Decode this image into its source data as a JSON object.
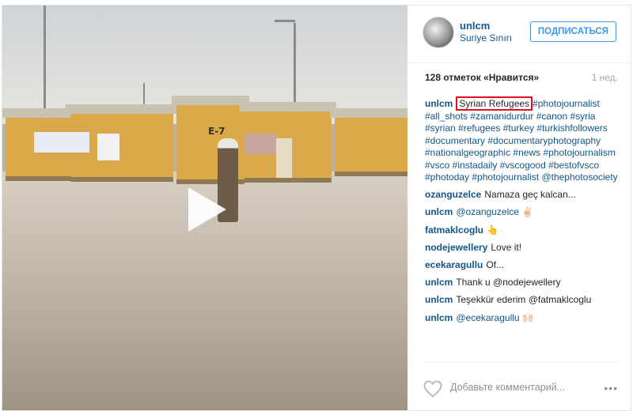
{
  "post": {
    "user": "unlcm",
    "location": "Suriye Sınırı",
    "follow_label": "ПОДПИСАТЬСЯ",
    "likes": "128 отметок «Нравится»",
    "time": "1 нед.",
    "video_sign": "E-7",
    "caption": {
      "author": "unlcm",
      "highlighted_text": "Syrian Refugees",
      "hashtags_line": "#photojournalist #all_shots #zamanidurdur #canon #syria #syrian #refugees #turkey #turkishfollowers #documentary #documentaryphotography #nationalgeographic #news #photojournalism #vsco #instadaily #vscogood #bestofvsco #photoday #photojournalist @thephotosociety"
    },
    "comments": [
      {
        "author": "ozanguzelce",
        "text": "Namaza geç kalcan..."
      },
      {
        "author": "unlcm",
        "text": "@ozanguzelce ✌🏻"
      },
      {
        "author": "fatmaklcoglu",
        "text": "👆"
      },
      {
        "author": "nodejewellery",
        "text": "Love it!"
      },
      {
        "author": "ecekaragullu",
        "text": "Of..."
      },
      {
        "author": "unlcm",
        "text": "Thank u @nodejewellery"
      },
      {
        "author": "unlcm",
        "text": "Teşekkür ederim @fatmaklcoglu"
      },
      {
        "author": "unlcm",
        "text": "@ecekaragullu 🙌🏻"
      }
    ],
    "add_comment_placeholder": "Добавьте комментарий...",
    "more_label": "•••"
  },
  "colors": {
    "link": "#125688",
    "follow_border": "#4090db",
    "highlight_box": "#e0101a"
  }
}
